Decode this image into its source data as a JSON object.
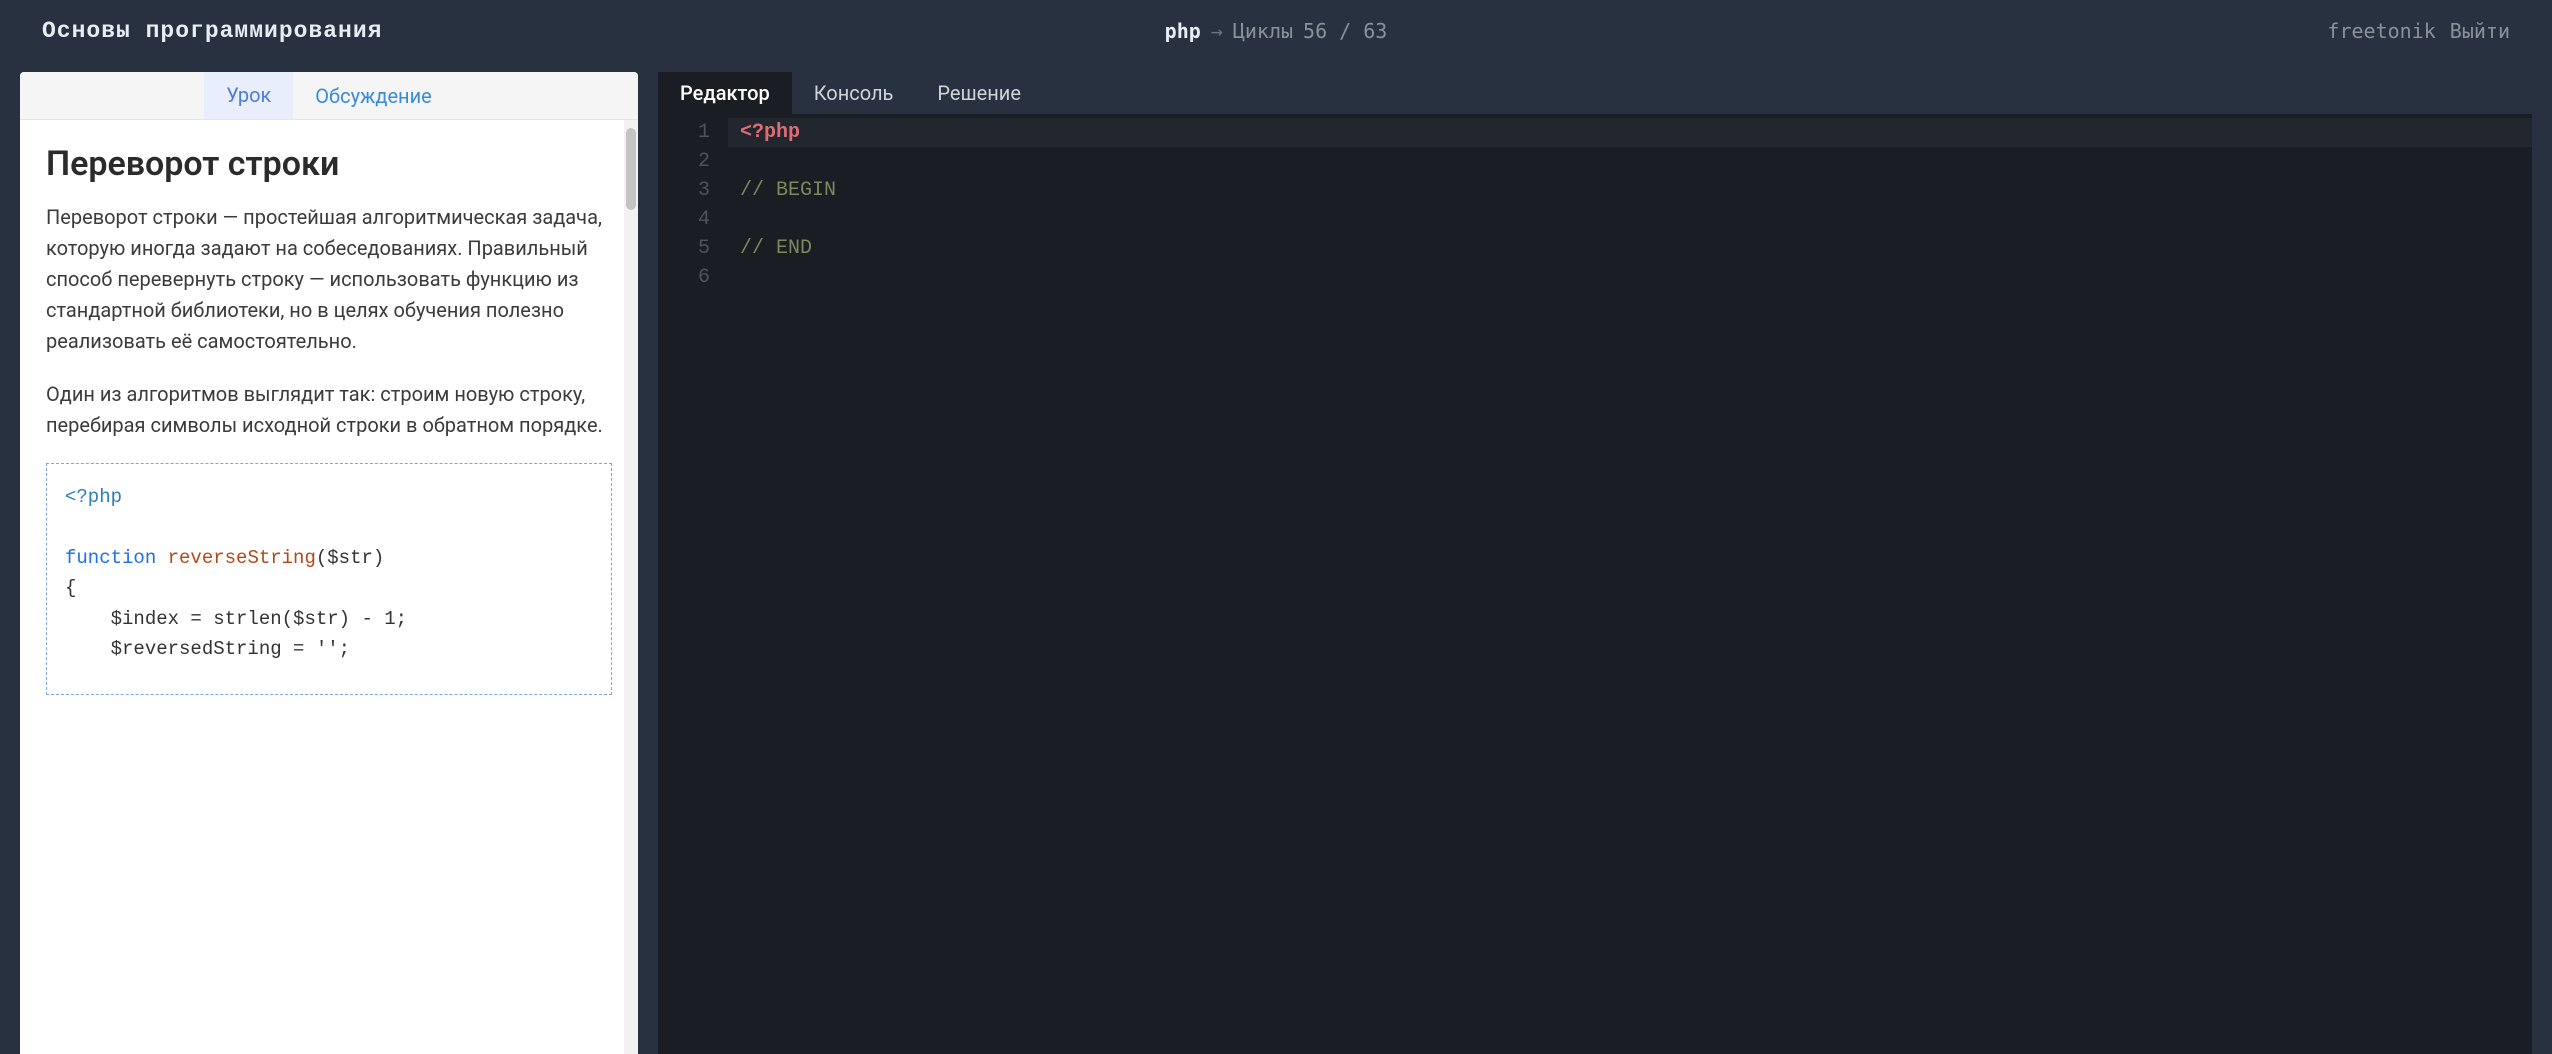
{
  "topbar": {
    "title": "Основы программирования",
    "breadcrumb": {
      "lang": "php",
      "arrow": "→",
      "topic": "Циклы",
      "count": "56 / 63"
    },
    "user": "freetonik",
    "logout": "Выйти"
  },
  "lesson": {
    "tabs": {
      "lesson": "Урок",
      "discussion": "Обсуждение"
    },
    "active_tab": "lesson",
    "heading": "Переворот строки",
    "para1": "Переворот строки — простейшая алгоритмическая задача, которую иногда задают на собеседованиях. Правильный способ перевернуть строку — использовать функцию из стандартной библиотеки, но в целях обучения полезно реализовать её самостоятельно.",
    "para2": "Один из алгоритмов выглядит так: строим новую строку, перебирая символы исходной строки в обратном порядке.",
    "code": {
      "open": "<?php",
      "kw_function": "function",
      "fn_name": "reverseString",
      "sig_rest": "($str)",
      "brace": "{",
      "l1": "    $index = strlen($str) - 1;",
      "l2": "    $reversedString = '';"
    }
  },
  "editor": {
    "tabs": {
      "editor": "Редактор",
      "console": "Консоль",
      "solution": "Решение"
    },
    "active_tab": "editor",
    "line_count": 6,
    "lines_raw": [
      "<?php",
      "",
      "// BEGIN",
      "",
      "// END",
      ""
    ],
    "tokens": {
      "open": "<?php",
      "begin": "// BEGIN",
      "end": "// END"
    },
    "cursor_line": 1
  }
}
